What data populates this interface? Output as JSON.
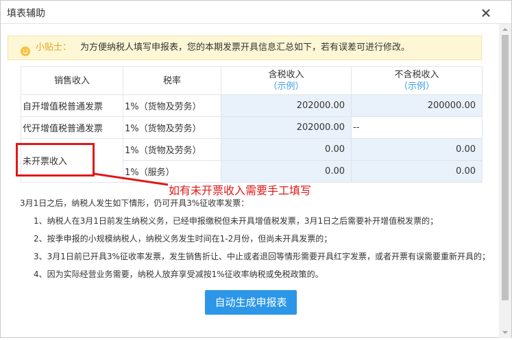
{
  "dialog": {
    "title": "填表辅助"
  },
  "tip": {
    "label": "小贴士：",
    "text": "为方便纳税人填写申报表，您的本期发票开具信息汇总如下，若有误差可进行修改。",
    "icon": "smiley-icon"
  },
  "table": {
    "headers": {
      "sales": "销售收入",
      "rate": "税率",
      "incl_tax": "含税收入",
      "excl_tax": "不含税收入",
      "example": "（示例）"
    },
    "rows": [
      {
        "category": "自开增值税普通发票",
        "rate": "1%（货物及劳务）",
        "incl": "202000.00",
        "excl": "200000.00"
      },
      {
        "category": "代开增值税普通发票",
        "rate": "1%（货物及劳务）",
        "incl": "202000.00",
        "excl": "--"
      },
      {
        "category": "未开票收入",
        "rate": "1%（货物及劳务）",
        "incl": "0.00",
        "excl": "0.00"
      },
      {
        "category": "",
        "rate": "1%（服务）",
        "incl": "0.00",
        "excl": "0.00"
      }
    ]
  },
  "annotation": {
    "text": "如有未开票收入需要手工填写",
    "color": "#e01818"
  },
  "notes": {
    "intro": "3月1日之后，纳税人发生如下情形，仍可开具3%征收率发票：",
    "items": [
      "1、纳税人在3月1日前发生纳税义务，已经申报缴税但未开具增值税发票，3月1日之后需要补开增值税发票的；",
      "2、按季申报的小规模纳税人，纳税义务发生时间在1-2月份，但尚未开具发票的；",
      "3、3月1日前已开具3%征收率发票，发生销售折让、中止或者退回等情形需要开具红字发票，或者开票有误需要重新开具的；",
      "4、因为实际经营业务需要，纳税人放弃享受减按1%征收率纳税或免税政策的。"
    ]
  },
  "button": {
    "generate": "自动生成申报表"
  },
  "colors": {
    "accent": "#2c97e8",
    "link": "#3c9be5",
    "tip_bg": "#fef7d5",
    "tip_label": "#e8a21a",
    "cell_bg": "#e9f1fb"
  }
}
